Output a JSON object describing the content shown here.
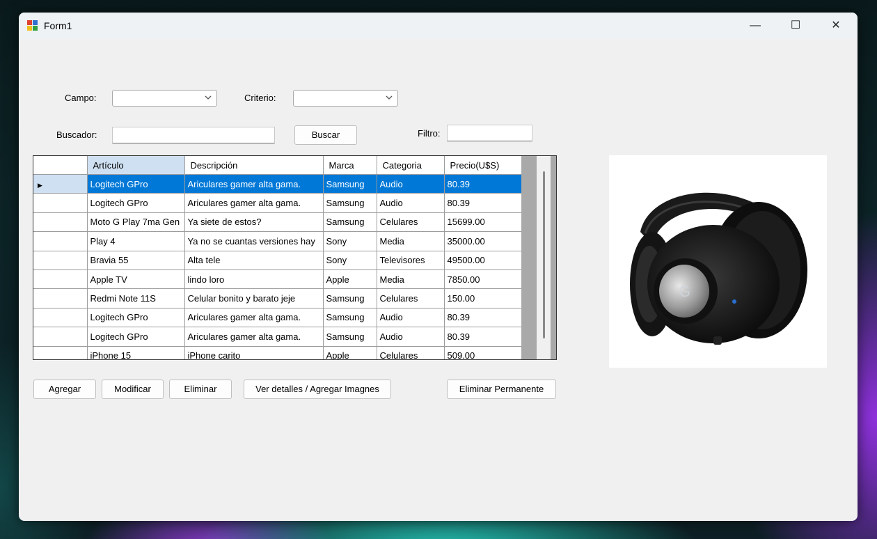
{
  "window": {
    "title": "Form1"
  },
  "titlebar": {
    "minimize": "—",
    "maximize": "☐",
    "close": "✕"
  },
  "search": {
    "campo_label": "Campo:",
    "campo_value": "",
    "criterio_label": "Criterio:",
    "criterio_value": "",
    "buscador_label": "Buscador:",
    "buscador_value": "",
    "buscar_button": "Buscar",
    "filtro_label": "Filtro:",
    "filtro_value": ""
  },
  "grid": {
    "columns": [
      "Artículo",
      "Descripción",
      "Marca",
      "Categoria",
      "Precio(U$S)"
    ],
    "rows": [
      [
        "Logitech GPro",
        "Ariculares gamer alta gama.",
        "Samsung",
        "Audio",
        "80.39"
      ],
      [
        "Logitech GPro",
        "Ariculares gamer alta gama.",
        "Samsung",
        "Audio",
        "80.39"
      ],
      [
        "Moto G Play 7ma Gen",
        "Ya siete de estos?",
        "Samsung",
        "Celulares",
        "15699.00"
      ],
      [
        "Play 4",
        "Ya no se cuantas versiones hay",
        "Sony",
        "Media",
        "35000.00"
      ],
      [
        "Bravia 55",
        "Alta tele",
        "Sony",
        "Televisores",
        "49500.00"
      ],
      [
        "Apple TV",
        "lindo loro",
        "Apple",
        "Media",
        "7850.00"
      ],
      [
        "Redmi Note 11S",
        "Celular bonito y barato jeje",
        "Samsung",
        "Celulares",
        "150.00"
      ],
      [
        "Logitech GPro",
        "Ariculares gamer alta gama.",
        "Samsung",
        "Audio",
        "80.39"
      ],
      [
        "Logitech GPro",
        "Ariculares gamer alta gama.",
        "Samsung",
        "Audio",
        "80.39"
      ],
      [
        "iPhone 15",
        "iPhone carito",
        "Apple",
        "Celulares",
        "509.00"
      ]
    ],
    "selected_row": 0,
    "row_indicator": "▶"
  },
  "actions": {
    "agregar": "Agregar",
    "modificar": "Modificar",
    "eliminar": "Eliminar",
    "detalles": "Ver detalles / Agregar Imagnes",
    "eliminar_permanente": "Eliminar Permanente"
  },
  "image": {
    "icon": "headphones-icon"
  },
  "colors": {
    "selection": "#0078d7",
    "header_selected": "#cfe0f2"
  }
}
